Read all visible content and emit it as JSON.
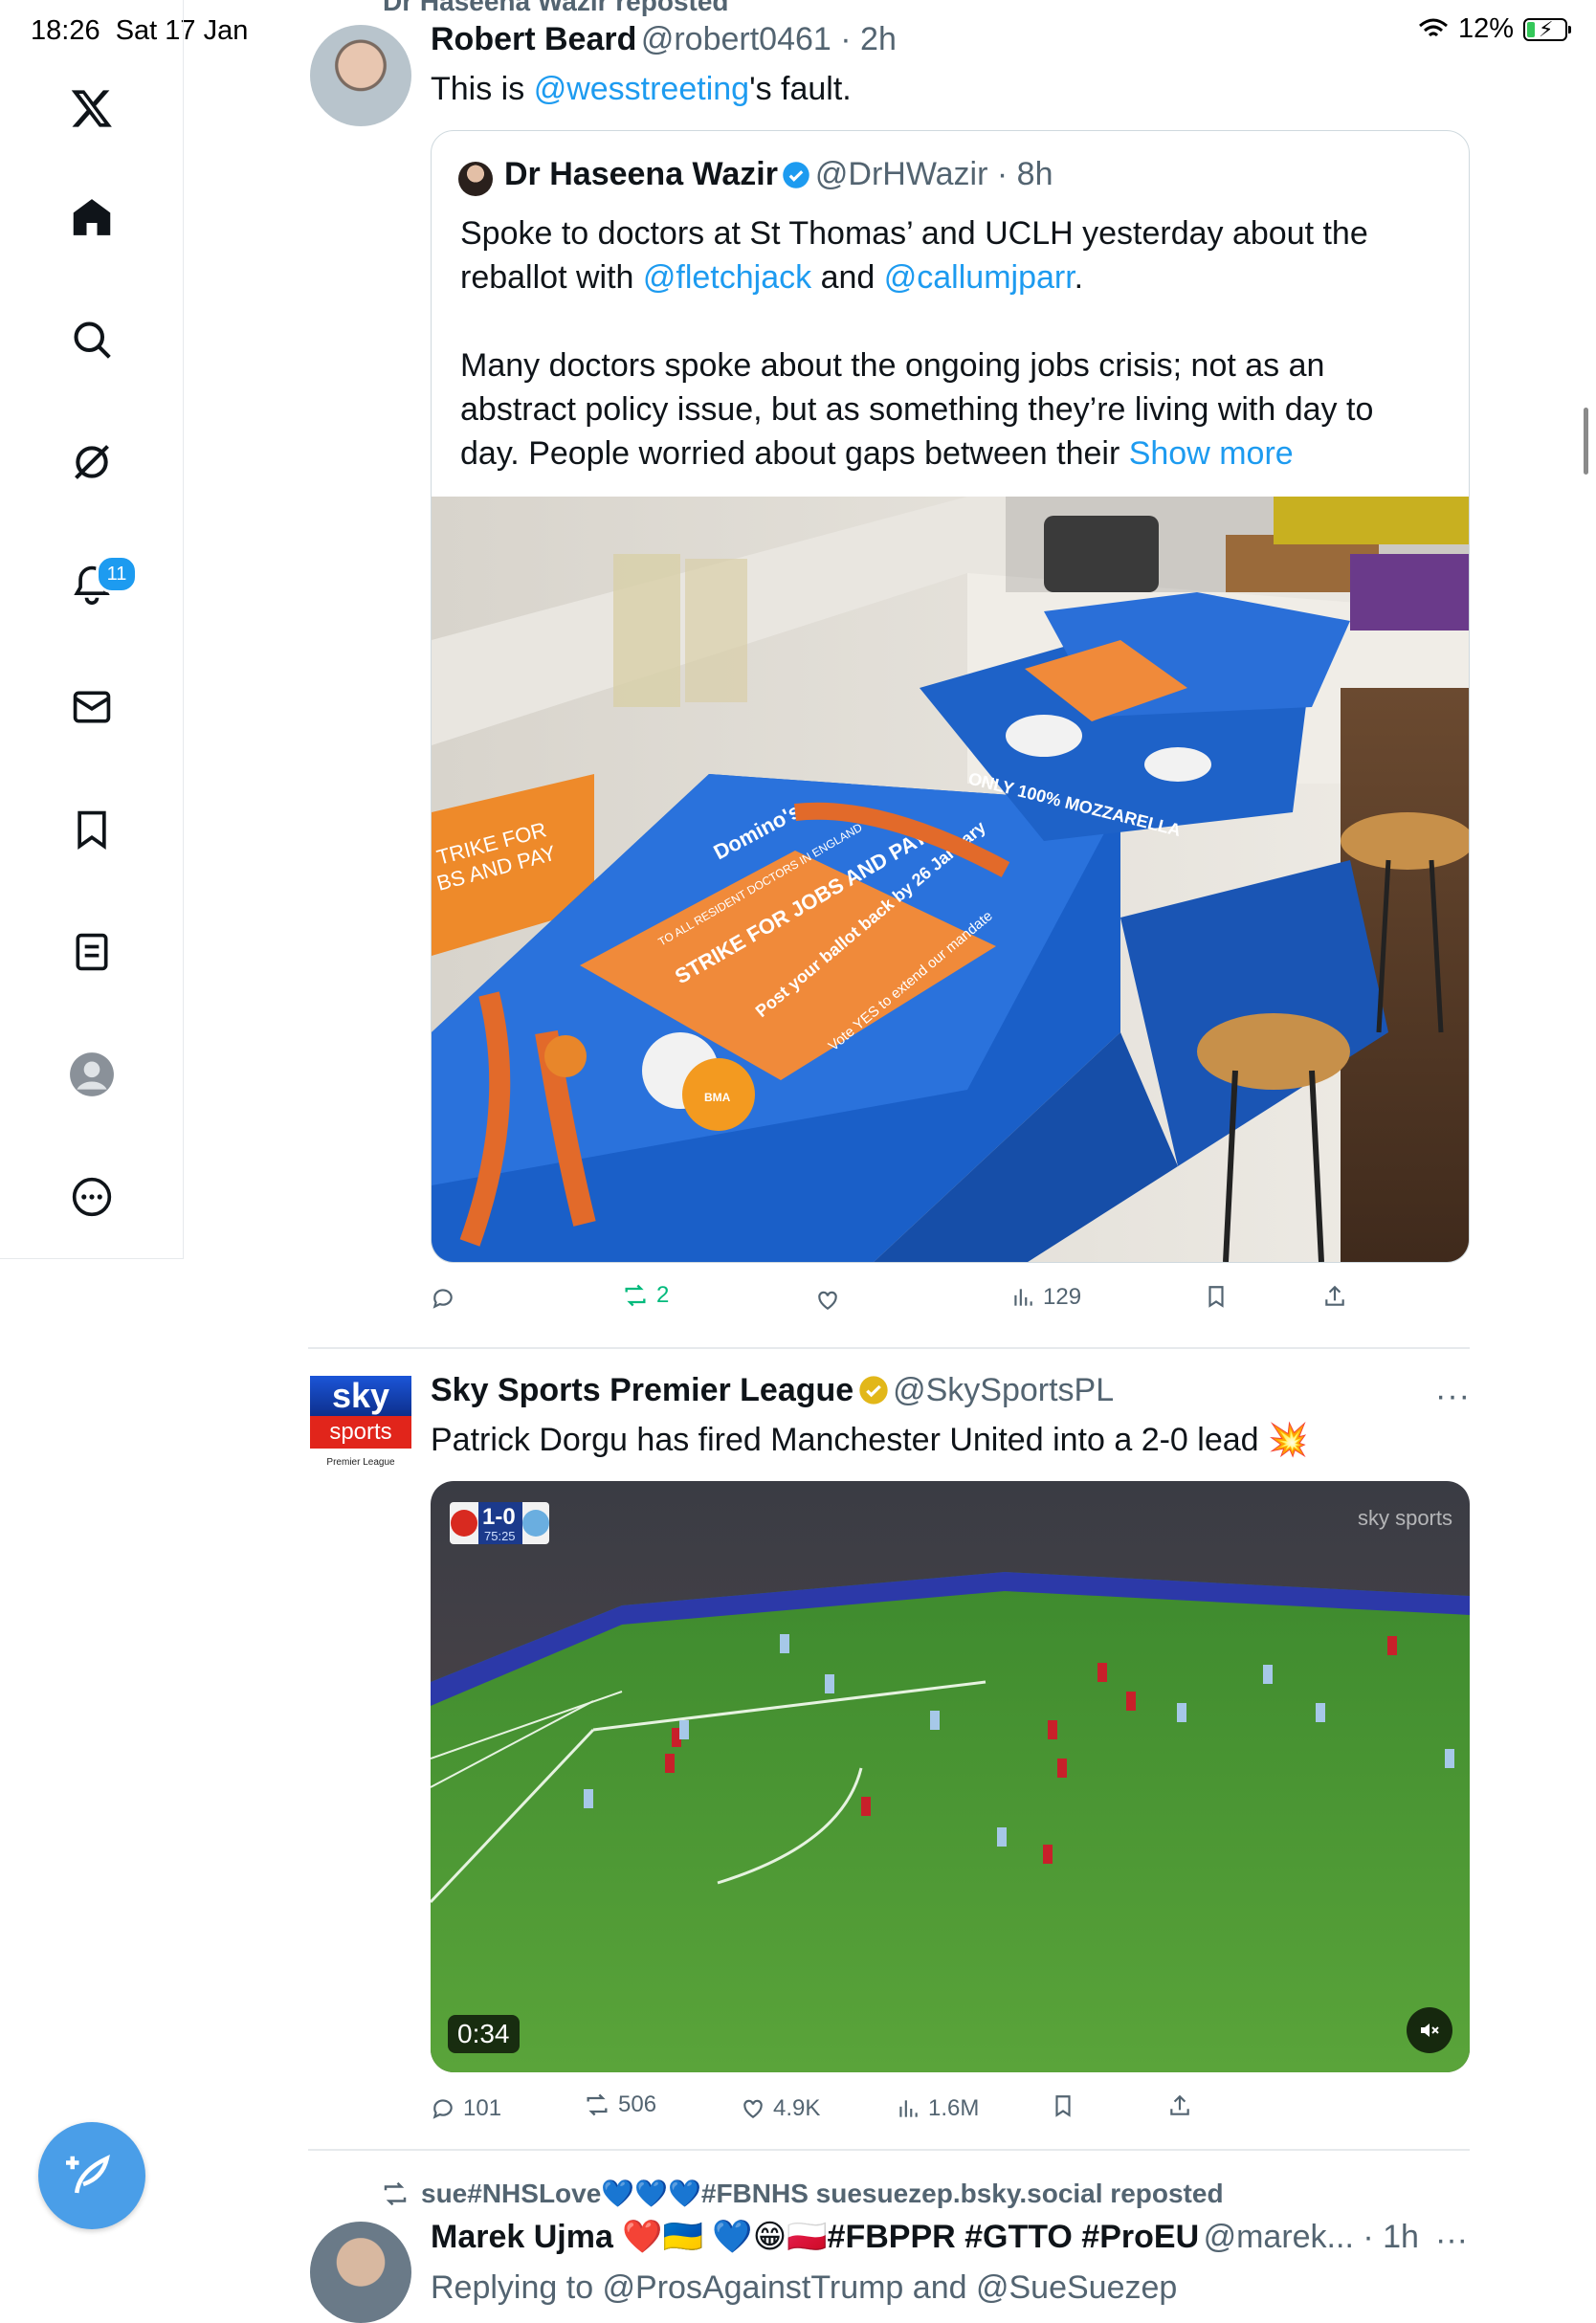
{
  "status_bar": {
    "time": "18:26",
    "date": "Sat 17 Jan",
    "battery": "12%"
  },
  "sidebar": {
    "notifications_badge": "11",
    "items": [
      "home",
      "explore",
      "grok",
      "notifications",
      "messages",
      "bookmarks",
      "lists",
      "profile",
      "more"
    ]
  },
  "posts": [
    {
      "repost_line": "Dr Haseena Wazir reposted",
      "name": "Robert Beard",
      "handle": "@robert0461",
      "time": "2h",
      "text_before": "This is ",
      "text_link": "@wesstreeting",
      "text_after": "'s fault.",
      "quote": {
        "name": "Dr Haseena Wazir",
        "handle": "@DrHWazir",
        "time": "8h",
        "p1_a": "Spoke to doctors at St Thomas’ and UCLH yesterday about the reballot with ",
        "p1_link1": "@fletchjack",
        "p1_mid": " and ",
        "p1_link2": "@callumjparr",
        "p1_end": ".",
        "p2": "Many doctors spoke about the ongoing jobs crisis; not as an abstract policy issue, but as something they’re living with day to day. People worried about gaps between their ",
        "show_more": "Show more",
        "image_texts": {
          "leaflet_main": "STRIKE FOR JOBS AND PAY",
          "leaflet_sub": "TO ALL RESIDENT DOCTORS IN ENGLAND",
          "leaflet_post": "Post your ballot back by 26 January",
          "leaflet_vote": "Vote YES to extend our mandate",
          "bma": "BMA",
          "box_brand": "Domino's",
          "box_text": "ONLY 100% MOZZARELLA"
        }
      },
      "stats": {
        "replies": "",
        "reposts": "2",
        "likes": "",
        "views": "129"
      }
    },
    {
      "name": "Sky Sports Premier League",
      "handle": "@SkySportsPL",
      "time": "",
      "text": "Patrick Dorgu has fired Manchester United into a 2-0 lead",
      "emoji": "💥",
      "video": {
        "score": "1-0",
        "clock": "75:25",
        "watermark": "sky sports",
        "duration": "0:34"
      },
      "avatar": {
        "top": "sky",
        "bottom": "sports",
        "small": "Premier League"
      },
      "stats": {
        "replies": "101",
        "reposts": "506",
        "likes": "4.9K",
        "views": "1.6M"
      }
    },
    {
      "repost_line": "sue#NHSLove💙💙💙#FBNHS suesuezep.bsky.social reposted",
      "name": "Marek Ujma ❤️🇺🇦 💙😁🇵🇱#FBPPR #GTTO #ProEU",
      "handle": "@marek...",
      "time": "1h",
      "partial": "Replying to @ProsAgainstTrump and @SueSuezep"
    }
  ]
}
